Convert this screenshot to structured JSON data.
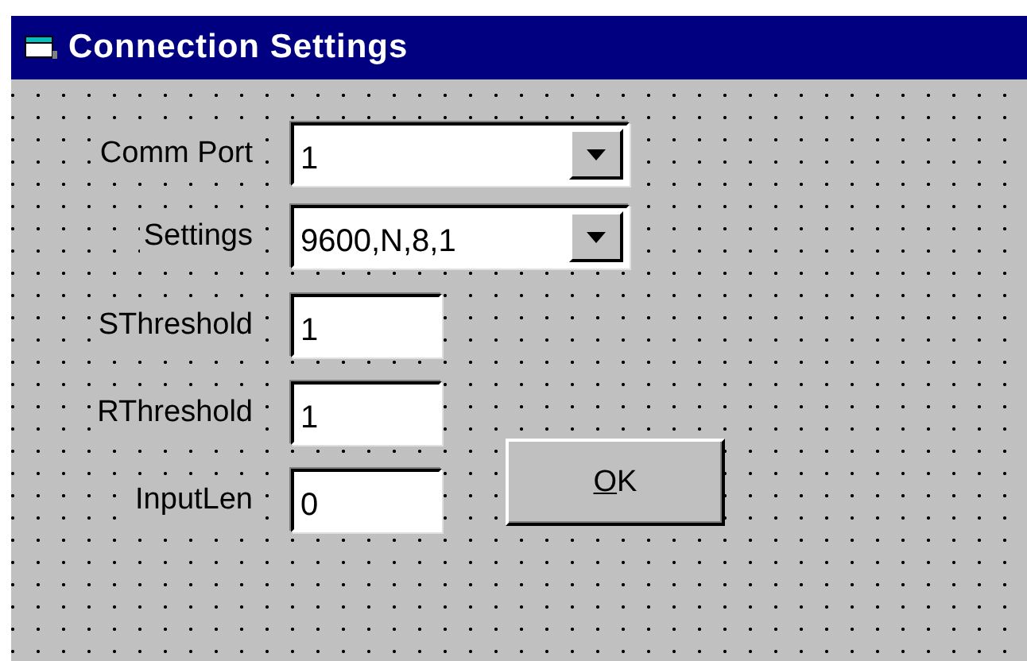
{
  "window": {
    "title": "Connection Settings"
  },
  "fields": [
    {
      "label": "Comm Port",
      "kind": "combo",
      "value": "1"
    },
    {
      "label": "Settings",
      "kind": "combo",
      "value": "9600,N,8,1"
    },
    {
      "label": "SThreshold",
      "kind": "text",
      "value": "1"
    },
    {
      "label": "RThreshold",
      "kind": "text",
      "value": "1"
    },
    {
      "label": "InputLen",
      "kind": "text",
      "value": "0"
    }
  ],
  "ok_button": {
    "label": "OK",
    "mnemonic_underlined": true
  }
}
